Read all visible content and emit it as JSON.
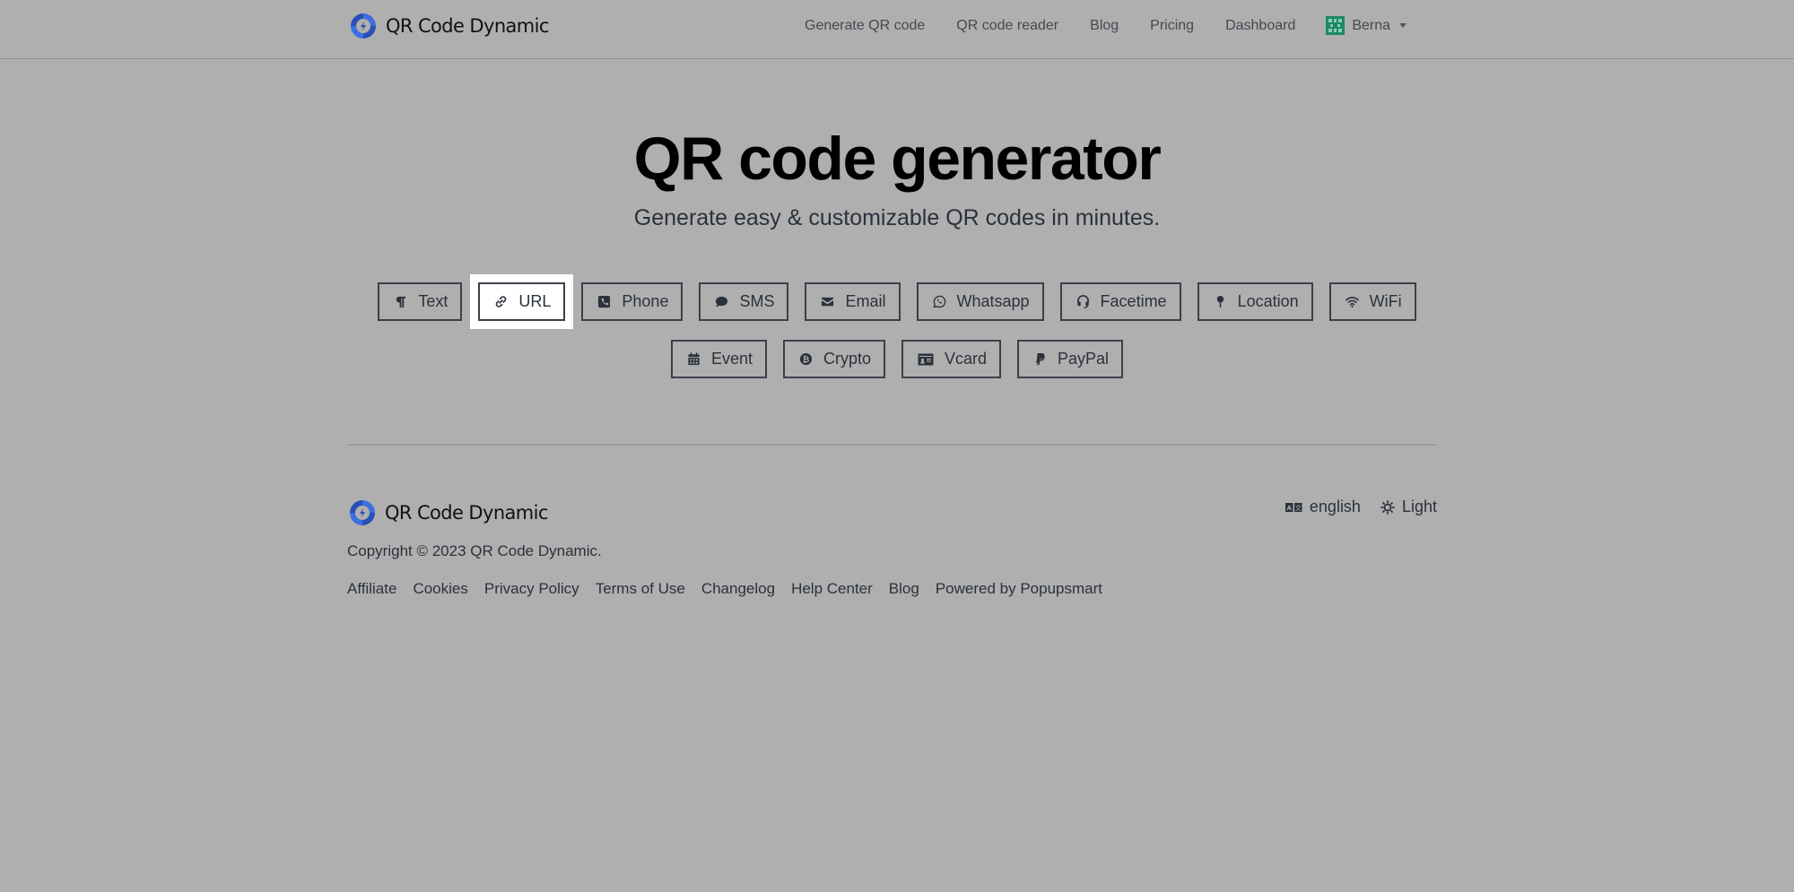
{
  "header": {
    "brand": "QR Code Dynamic",
    "nav": [
      "Generate QR code",
      "QR code reader",
      "Blog",
      "Pricing",
      "Dashboard"
    ],
    "user": "Berna"
  },
  "hero": {
    "title": "QR code generator",
    "subtitle": "Generate easy & customizable QR codes in minutes."
  },
  "qr_types": {
    "active": "URL",
    "row1": [
      {
        "label": "Text",
        "icon": "paragraph-icon"
      },
      {
        "label": "URL",
        "icon": "link-icon"
      },
      {
        "label": "Phone",
        "icon": "phone-icon"
      },
      {
        "label": "SMS",
        "icon": "sms-icon"
      },
      {
        "label": "Email",
        "icon": "envelope-icon"
      },
      {
        "label": "Whatsapp",
        "icon": "whatsapp-icon"
      },
      {
        "label": "Facetime",
        "icon": "headset-icon"
      },
      {
        "label": "Location",
        "icon": "map-pin-icon"
      },
      {
        "label": "WiFi",
        "icon": "wifi-icon"
      }
    ],
    "row2": [
      {
        "label": "Event",
        "icon": "calendar-icon"
      },
      {
        "label": "Crypto",
        "icon": "bitcoin-icon"
      },
      {
        "label": "Vcard",
        "icon": "id-card-icon"
      },
      {
        "label": "PayPal",
        "icon": "paypal-icon"
      }
    ]
  },
  "footer": {
    "brand": "QR Code Dynamic",
    "copyright": "Copyright © 2023 QR Code Dynamic.",
    "links": [
      "Affiliate",
      "Cookies",
      "Privacy Policy",
      "Terms of Use",
      "Changelog",
      "Help Center",
      "Blog",
      "Powered by Popupsmart"
    ],
    "language": "english",
    "theme": "Light"
  },
  "colors": {
    "brand_blue": "#2d5bd6",
    "avatar_green": "#1c8a66",
    "overlay_bg": "#afafaf"
  }
}
